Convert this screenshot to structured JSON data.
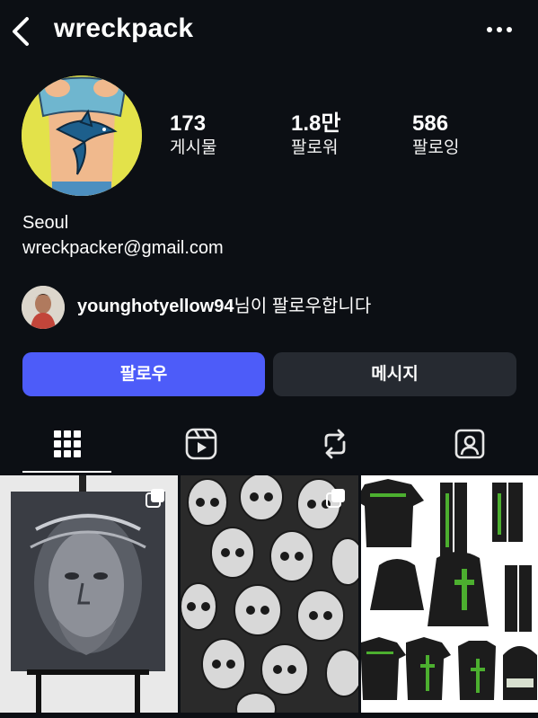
{
  "header": {
    "username": "wreckpack",
    "back_icon": "chevron-left-icon",
    "more_icon": "more-horizontal-icon"
  },
  "stats": [
    {
      "value": "173",
      "label": "게시물"
    },
    {
      "value": "1.8만",
      "label": "팔로워"
    },
    {
      "value": "586",
      "label": "팔로잉"
    }
  ],
  "bio": {
    "location": "Seoul",
    "email": "wreckpacker@gmail.com"
  },
  "followed_by": {
    "name": "younghotyellow94",
    "suffix": "님이 팔로우합니다"
  },
  "actions": {
    "follow_label": "팔로우",
    "message_label": "메시지"
  },
  "tabs": [
    {
      "icon": "grid-icon",
      "active": true
    },
    {
      "icon": "reels-icon",
      "active": false
    },
    {
      "icon": "repost-icon",
      "active": false
    },
    {
      "icon": "tagged-icon",
      "active": false
    }
  ],
  "colors": {
    "background": "#0c0f14",
    "primary_button": "#4d5cf9",
    "secondary_button": "#262a31",
    "avatar_bg": "#e3e24a"
  }
}
